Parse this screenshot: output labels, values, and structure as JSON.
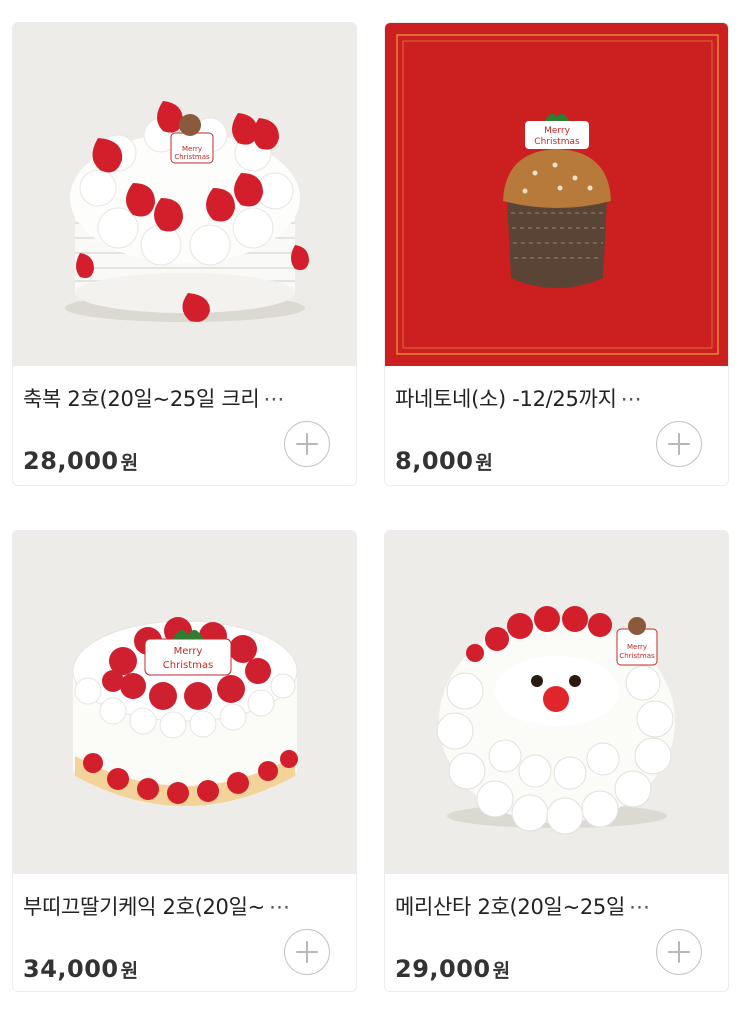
{
  "products": [
    {
      "name": "축복 2호(20일~25일 크리",
      "ellipsis": "⋯",
      "price": "28,000",
      "unit": "원",
      "badge_text": "Merry Christmas",
      "image_icon": "strawberry-cream-cake",
      "bg": "#eeece8"
    },
    {
      "name": "파네토네(소) -12/25까지",
      "ellipsis": "⋯",
      "price": "8,000",
      "unit": "원",
      "badge_text": "Merry Christmas",
      "image_icon": "panettone",
      "bg": "#cc1f1f"
    },
    {
      "name": "부띠끄딸기케익 2호(20일~",
      "ellipsis": "⋯",
      "price": "34,000",
      "unit": "원",
      "badge_text": "Merry Christmas",
      "image_icon": "strawberry-boutique-cake",
      "bg": "#eeece8"
    },
    {
      "name": "메리산타 2호(20일~25일",
      "ellipsis": "⋯",
      "price": "29,000",
      "unit": "원",
      "badge_text": "Merry Christmas",
      "image_icon": "santa-cake",
      "bg": "#eeece8"
    }
  ],
  "add_icon": "plus-circle-icon"
}
